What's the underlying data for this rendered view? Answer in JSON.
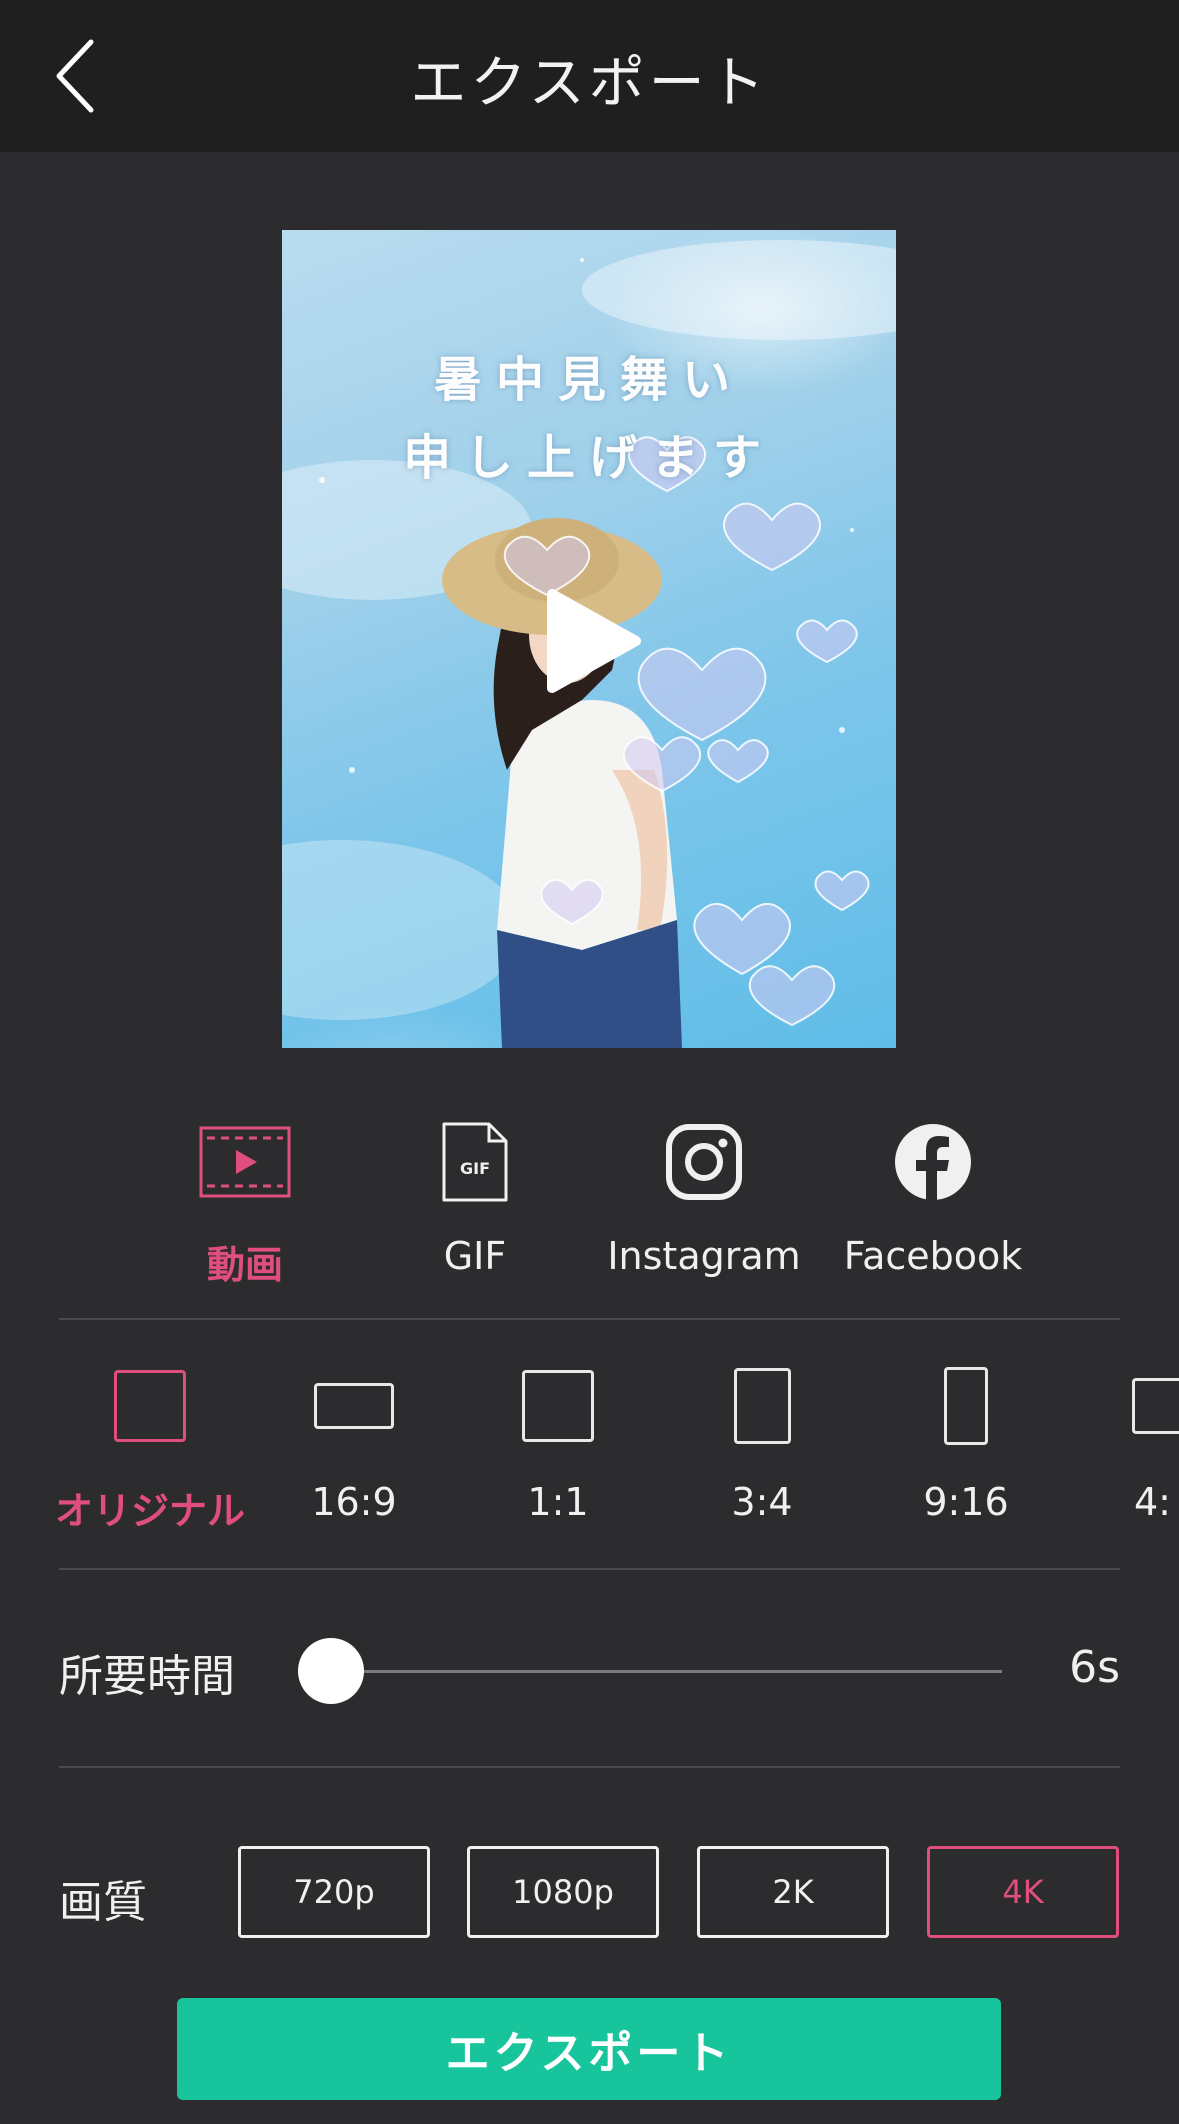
{
  "header": {
    "title": "エクスポート"
  },
  "preview": {
    "line1": "暑中見舞い",
    "line2": "申し上げます"
  },
  "export_types": [
    {
      "label": "動画",
      "icon": "video-icon",
      "active": true
    },
    {
      "label": "GIF",
      "icon": "gif-file-icon",
      "active": false
    },
    {
      "label": "Instagram",
      "icon": "instagram-icon",
      "active": false
    },
    {
      "label": "Facebook",
      "icon": "facebook-icon",
      "active": false
    }
  ],
  "aspect_ratios": [
    {
      "label": "オリジナル",
      "active": true
    },
    {
      "label": "16:9",
      "active": false
    },
    {
      "label": "1:1",
      "active": false
    },
    {
      "label": "3:4",
      "active": false
    },
    {
      "label": "9:16",
      "active": false
    },
    {
      "label": "4:",
      "active": false
    }
  ],
  "duration": {
    "label": "所要時間",
    "value": "6s",
    "slider_fraction": 0.0
  },
  "quality": {
    "label": "画質",
    "options": [
      "720p",
      "1080p",
      "2K",
      "4K"
    ],
    "selected": "4K"
  },
  "export_button": {
    "label": "エクスポート"
  },
  "colors": {
    "accent": "#e04e7d",
    "export_green": "#17c49c",
    "background": "#2c2c2e",
    "header": "#1f1f20"
  }
}
